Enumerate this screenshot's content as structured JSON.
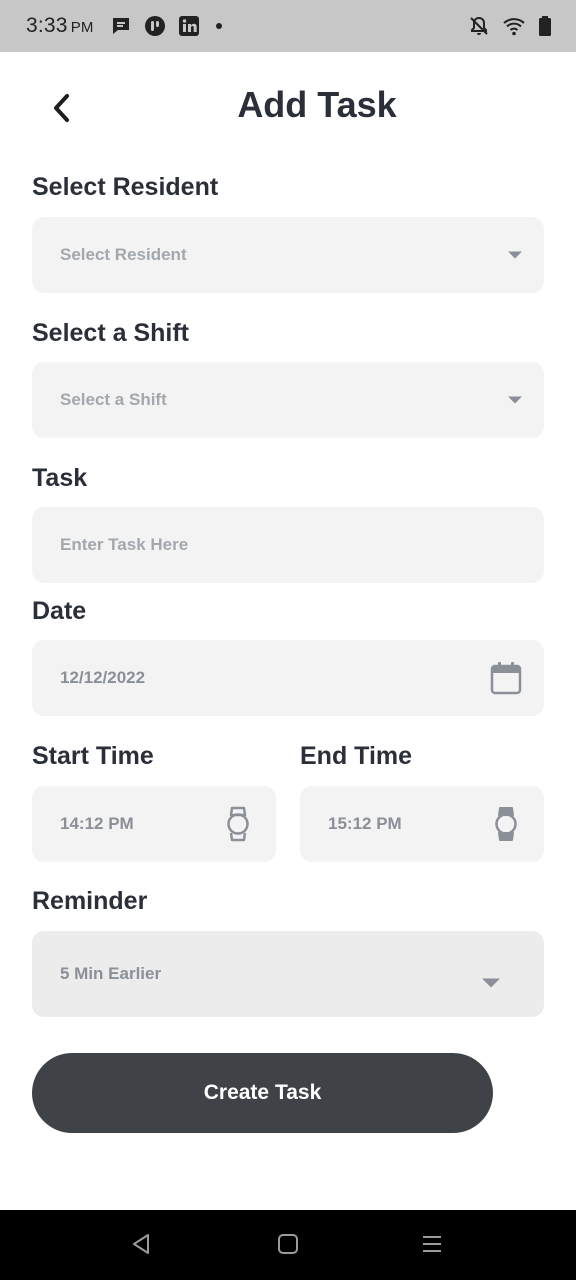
{
  "status_bar": {
    "time": "3:33",
    "ampm": "PM"
  },
  "header": {
    "title": "Add Task",
    "back_icon": "chevron-left-icon"
  },
  "form": {
    "resident": {
      "label": "Select Resident",
      "placeholder": "Select Resident",
      "icon": "caret-down-icon"
    },
    "shift": {
      "label": "Select a Shift",
      "placeholder": "Select a Shift",
      "icon": "caret-down-icon"
    },
    "task": {
      "label": "Task",
      "placeholder": "Enter Task Here"
    },
    "date": {
      "label": "Date",
      "value": "12/12/2022",
      "icon": "calendar-icon"
    },
    "start_time": {
      "label": "Start Time",
      "value": "14:12 PM",
      "icon": "watch-icon"
    },
    "end_time": {
      "label": "End Time",
      "value": "15:12 PM",
      "icon": "watch-icon"
    },
    "reminder": {
      "label": "Reminder",
      "value": "5 Min Earlier",
      "icon": "caret-down-icon"
    }
  },
  "actions": {
    "create_label": "Create Task"
  },
  "colors": {
    "primary_button": "#3f4347",
    "field_bg": "#f3f3f3",
    "text_dark": "#2b2f3a",
    "placeholder": "#a3a8ae"
  }
}
